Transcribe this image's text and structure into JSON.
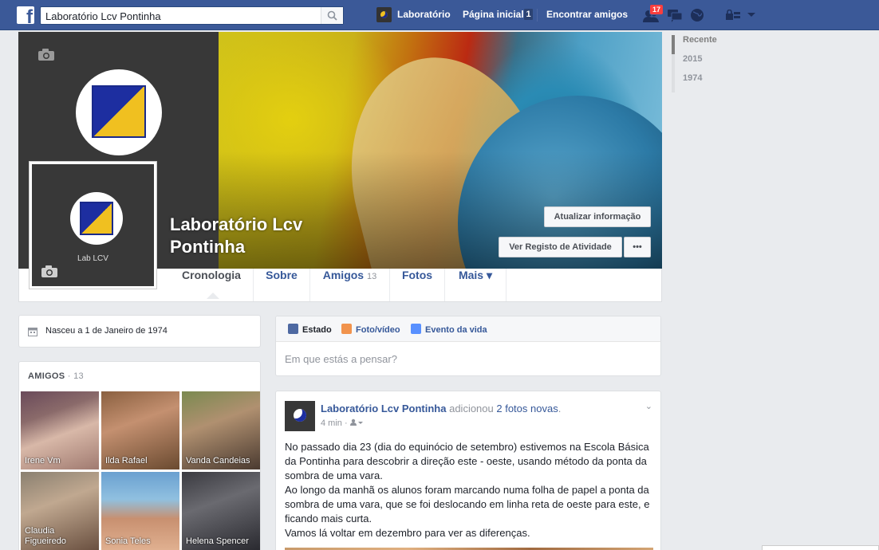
{
  "topbar": {
    "logo_letter": "f",
    "search_value": "Laboratório Lcv Pontinha",
    "profile_link": "Laboratório",
    "home_link": "Página inicial",
    "home_count": "1",
    "find_friends": "Encontrar amigos",
    "friend_requests_badge": "17"
  },
  "cover": {
    "page_name": "Laboratório Lcv Pontinha",
    "update_info_button": "Atualizar informação",
    "activity_log_button": "Ver Registo de Atividade",
    "more_button": "•••",
    "profile_label": "Lab LCV"
  },
  "tabs": [
    {
      "label": "Cronologia"
    },
    {
      "label": "Sobre"
    },
    {
      "label": "Amigos",
      "count": "13"
    },
    {
      "label": "Fotos"
    },
    {
      "label": "Mais ▾"
    }
  ],
  "timeline_nav": [
    "Recente",
    "2015",
    "1974"
  ],
  "intro": {
    "born": "Nasceu a 1 de Janeiro de 1974"
  },
  "friends": {
    "heading": "AMIGOS",
    "count": "13",
    "list": [
      {
        "name": "Irene Vm"
      },
      {
        "name": "Ilda Rafael"
      },
      {
        "name": "Vanda Candeias"
      },
      {
        "name": "Claudia Figueiredo"
      },
      {
        "name": "Sonia Teles"
      },
      {
        "name": "Helena Spencer"
      }
    ]
  },
  "composer": {
    "tabs": [
      "Estado",
      "Foto/vídeo",
      "Evento da vida"
    ],
    "placeholder": "Em que estás a pensar?"
  },
  "post": {
    "author": "Laboratório Lcv Pontinha",
    "action": "adicionou",
    "object": "2 fotos novas",
    "time": "4 min",
    "lines": [
      "No passado dia 23 (dia do equinócio de setembro) estivemos na Escola Básica da Pontinha para descobrir a direção este - oeste, usando método da ponta da sombra de uma vara.",
      "Ao longo da manhã os alunos foram marcando numa folha de papel a ponta da sombra de uma vara, que se foi deslocando em linha reta de oeste para este, e ficando mais curta.",
      "Vamos lá voltar em dezembro para ver as diferenças."
    ]
  }
}
